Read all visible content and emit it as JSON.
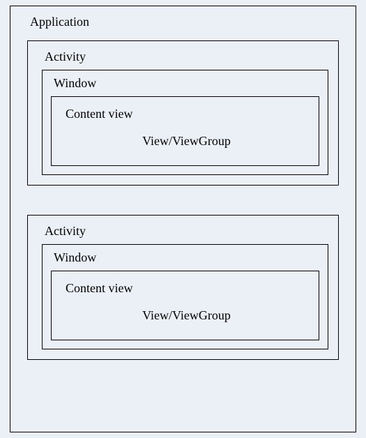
{
  "application": {
    "label": "Application",
    "activities": [
      {
        "label": "Activity",
        "window": {
          "label": "Window",
          "contentView": {
            "label": "Content view",
            "child": "View/ViewGroup"
          }
        }
      },
      {
        "label": "Activity",
        "window": {
          "label": "Window",
          "contentView": {
            "label": "Content view",
            "child": "View/ViewGroup"
          }
        }
      }
    ]
  }
}
